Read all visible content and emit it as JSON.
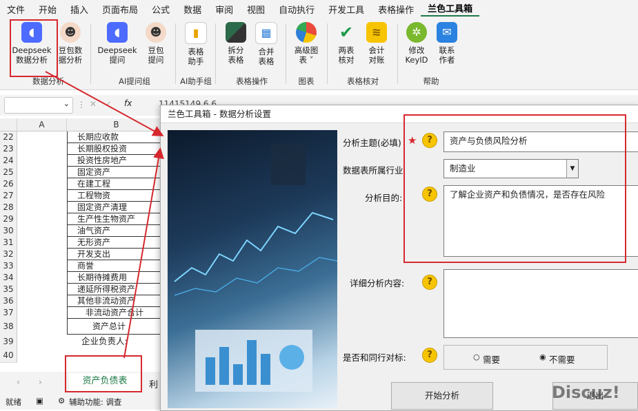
{
  "menu": [
    "文件",
    "开始",
    "插入",
    "页面布局",
    "公式",
    "数据",
    "审阅",
    "视图",
    "自动执行",
    "开发工具",
    "表格操作",
    "兰色工具箱"
  ],
  "ribbon": {
    "buttons": [
      {
        "label1": "Deepseek",
        "label2": "数据分析",
        "icon": "deepseek-whale-icon"
      },
      {
        "label1": "豆包数",
        "label2": "据分析",
        "icon": "doubao-avatar-icon"
      },
      {
        "label1": "Deepseek",
        "label2": "提问",
        "icon": "deepseek-whale-icon"
      },
      {
        "label1": "豆包",
        "label2": "提问",
        "icon": "doubao-avatar-icon"
      },
      {
        "label1": "表格",
        "label2": "助手",
        "icon": "chart-assistant-icon"
      },
      {
        "label1": "拆分",
        "label2": "表格",
        "icon": "split-table-icon"
      },
      {
        "label1": "合并",
        "label2": "表格",
        "icon": "merge-table-icon"
      },
      {
        "label1": "高级图",
        "label2": "表 ˅",
        "icon": "pie-chart-icon"
      },
      {
        "label1": "两表",
        "label2": "核对",
        "icon": "checkmark-icon"
      },
      {
        "label1": "会计",
        "label2": "对账",
        "icon": "coins-icon"
      },
      {
        "label1": "修改",
        "label2": "KeyID",
        "icon": "key-gear-icon"
      },
      {
        "label1": "联系",
        "label2": "作者",
        "icon": "mail-icon"
      }
    ],
    "groups": [
      "数据分析",
      "AI提问组",
      "AI助手组",
      "表格操作",
      "图表",
      "表格核对",
      "帮助"
    ]
  },
  "formula": {
    "fx": "fx",
    "value": "11415149.6.6"
  },
  "sheet": {
    "col_a": "A",
    "col_b": "B",
    "rows": [
      {
        "num": "22",
        "b": "长期应收款"
      },
      {
        "num": "23",
        "b": "长期股权投资"
      },
      {
        "num": "24",
        "b": "投资性房地产"
      },
      {
        "num": "25",
        "b": "固定资产"
      },
      {
        "num": "26",
        "b": "在建工程"
      },
      {
        "num": "27",
        "b": "工程物资"
      },
      {
        "num": "28",
        "b": "固定资产清理"
      },
      {
        "num": "29",
        "b": "生产性生物资产"
      },
      {
        "num": "30",
        "b": "油气资产"
      },
      {
        "num": "31",
        "b": "无形资产"
      },
      {
        "num": "32",
        "b": "开发支出"
      },
      {
        "num": "33",
        "b": "商誉"
      },
      {
        "num": "34",
        "b": "长期待摊费用"
      },
      {
        "num": "35",
        "b": "递延所得税资产"
      },
      {
        "num": "36",
        "b": "其他非流动资产"
      },
      {
        "num": "37",
        "b": "非流动资产合计"
      },
      {
        "num": "38",
        "b": "资产总计"
      },
      {
        "num": "39",
        "b": "企业负责人:"
      },
      {
        "num": "40",
        "b": ""
      }
    ],
    "tabs": [
      "资产负债表",
      "利"
    ],
    "status_ready": "就绪",
    "status_accessibility": "辅助功能: 调查"
  },
  "dialog": {
    "title": "兰色工具箱 - 数据分析设置",
    "topic_label": "分析主题(必填)",
    "topic_value": "资产与负债风险分析",
    "industry_label": "数据表所属行业",
    "industry_value": "制造业",
    "purpose_label": "分析目的:",
    "purpose_value": "了解企业资产和负债情况，是否存在风险",
    "detail_label": "详细分析内容:",
    "detail_value": "",
    "benchmark_label": "是否和同行对标:",
    "opt_need": "需要",
    "opt_no_need": "不需要",
    "start_button": "开始分析",
    "other_button": "退出",
    "help_glyph": "?"
  },
  "watermark": "Discuz!",
  "colors": {
    "accent": "#1e7a46",
    "highlight": "#d6272e",
    "help": "#f6c400"
  }
}
